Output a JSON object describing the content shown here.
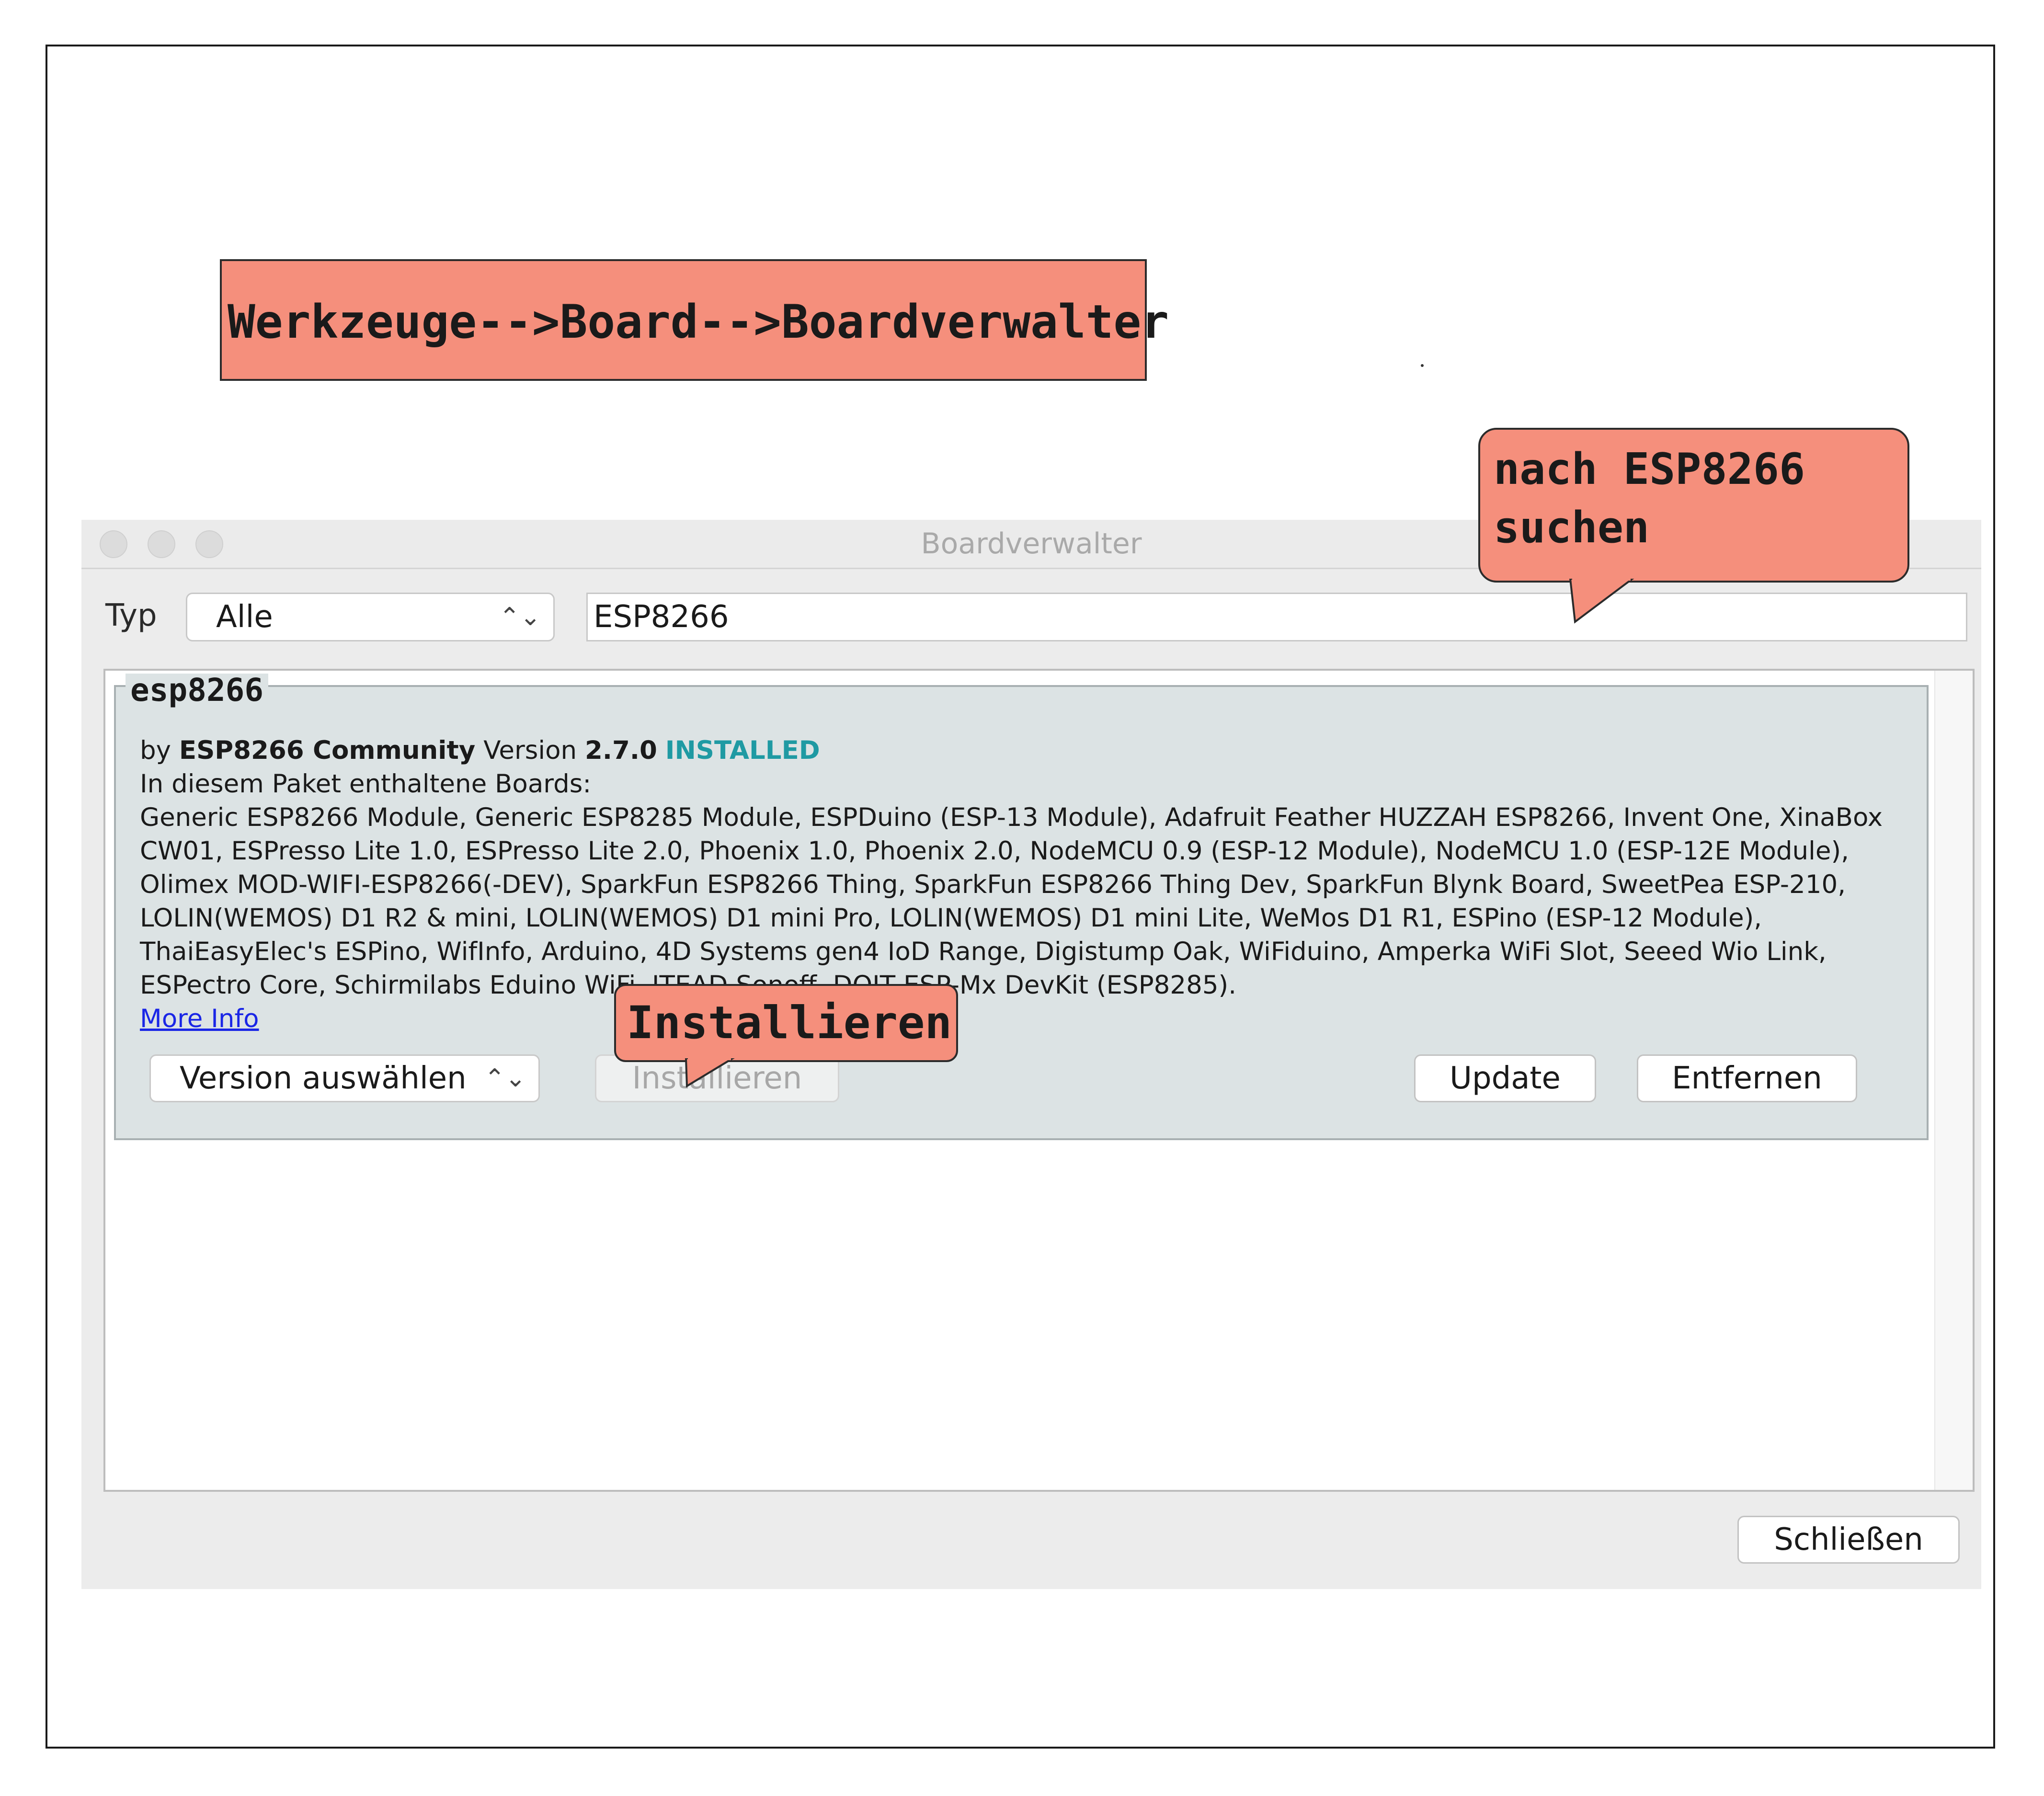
{
  "annotations": {
    "menu_path": "Werkzeuge-->Board-->Boardverwalter",
    "search_hint_line1": "nach ESP8266",
    "search_hint_line2": "suchen",
    "install_hint": "Installieren"
  },
  "window": {
    "title": "Boardverwalter"
  },
  "filter": {
    "type_label": "Typ",
    "type_value": "Alle",
    "search_value": "ESP8266"
  },
  "package": {
    "name": "esp8266",
    "by_prefix": "by",
    "author": "ESP8266 Community",
    "version_label": "Version",
    "version": "2.7.0",
    "status": "INSTALLED",
    "boards_heading": "In diesem Paket enthaltene Boards:",
    "boards_lines": [
      "Generic ESP8266 Module, Generic ESP8285 Module, ESPDuino (ESP-13 Module), Adafruit Feather HUZZAH ESP8266, Invent One, XinaBox",
      "CW01, ESPresso Lite 1.0, ESPresso Lite 2.0, Phoenix 1.0, Phoenix 2.0, NodeMCU 0.9 (ESP-12 Module), NodeMCU 1.0 (ESP-12E Module),",
      "Olimex MOD-WIFI-ESP8266(-DEV), SparkFun ESP8266 Thing, SparkFun ESP8266 Thing Dev, SparkFun Blynk Board, SweetPea ESP-210,",
      "LOLIN(WEMOS) D1 R2 & mini, LOLIN(WEMOS) D1 mini Pro, LOLIN(WEMOS) D1 mini Lite, WeMos D1 R1, ESPino (ESP-12 Module),",
      "ThaiEasyElec's ESPino, WifInfo, Arduino, 4D Systems gen4 IoD Range, Digistump Oak, WiFiduino, Amperka WiFi Slot, Seeed Wio Link,",
      "ESPectro Core, Schirmilabs Eduino WiFi, ITEAD Sonoff, DOIT ESP-Mx DevKit (ESP8285)."
    ],
    "more_info": "More Info",
    "version_select": "Version auswählen",
    "install_button": "Installieren",
    "update_button": "Update",
    "remove_button": "Entfernen"
  },
  "footer": {
    "close_button": "Schließen"
  },
  "colors": {
    "callout": "#f58f7c",
    "installed": "#1f9aa3",
    "link": "#1a26e6",
    "package_bg": "#dce3e4"
  },
  "icons": {
    "select_chevron": "updown-chevron-icon",
    "window_controls": "traffic-light-icon"
  }
}
